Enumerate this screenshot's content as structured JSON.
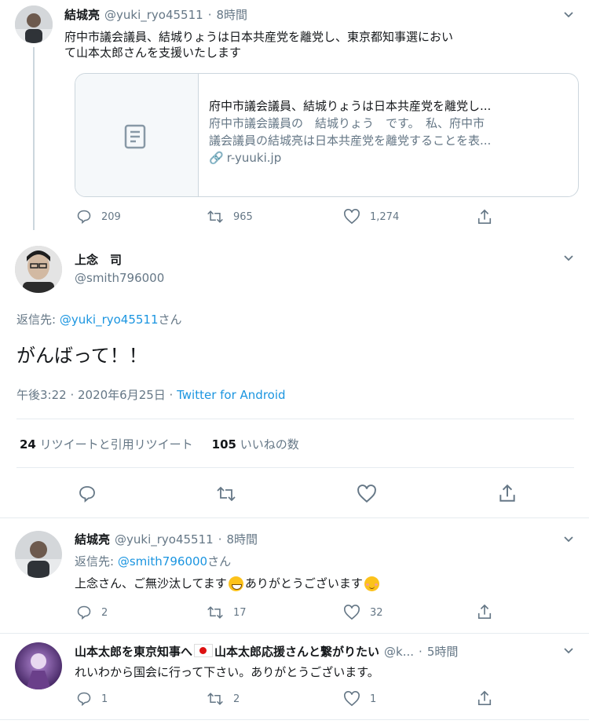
{
  "tweet1": {
    "name": "結城亮",
    "handle": "@yuki_ryo45511",
    "dot": "·",
    "time": "8時間",
    "text_line1": "府中市議会議員、結城りょうは日本共産党を離党し、東京都知事選におい",
    "text_line2": "て山本太郎さんを支援いたします",
    "card": {
      "title": "府中市議会議員、結城りょうは日本共産党を離党し...",
      "desc_line1": "府中市議会議員の　結城りょう　です。　私、府中市",
      "desc_line2": "議会議員の結城亮は日本共産党を離党することを表...",
      "domain": "r-yuuki.jp"
    },
    "replies": "209",
    "retweets": "965",
    "likes": "1,274"
  },
  "main_tweet": {
    "name": "上念　司",
    "handle": "@smith796000",
    "reply_to_label": "返信先: ",
    "reply_to_handle": "@yuki_ryo45511",
    "reply_to_suffix": "さん",
    "text": "がんばって！！",
    "time": "午後3:22 · 2020年6月25日 · ",
    "source": "Twitter for Android",
    "retweet_count": "24",
    "retweet_label": "リツイートと引用リツイート",
    "like_count": "105",
    "like_label": "いいねの数"
  },
  "reply1": {
    "name": "結城亮",
    "handle": "@yuki_ryo45511",
    "dot": "·",
    "time": "8時間",
    "reply_to_label": "返信先: ",
    "reply_to_handle": "@smith796000",
    "reply_to_suffix": "さん",
    "text_a": "上念さん、ご無沙汰してます",
    "text_b": "ありがとうございます",
    "replies": "2",
    "retweets": "17",
    "likes": "32"
  },
  "reply2": {
    "name_a": "山本太郎を東京知事へ",
    "name_b": "山本太郎応援さんと繋がりたい",
    "handle": "@k...",
    "dot": "·",
    "time": "5時間",
    "text": "れいわから国会に行って下さい。ありがとうございます。",
    "replies": "1",
    "retweets": "2",
    "likes": "1"
  },
  "colors": {
    "link": "#1b95e0",
    "muted": "#657786",
    "border": "#e6ecf0"
  }
}
